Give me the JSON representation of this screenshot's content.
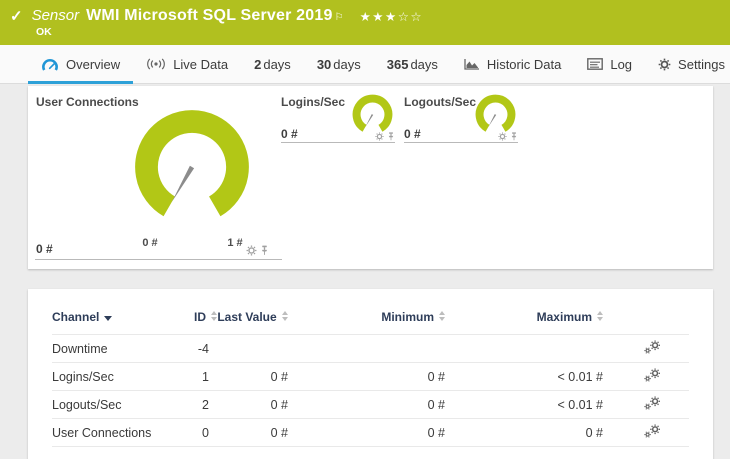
{
  "header": {
    "status_icon": "check",
    "kind_label": "Sensor",
    "title": "WMI Microsoft SQL Server 2019",
    "status": "OK",
    "rating": {
      "filled": 3,
      "total": 5,
      "filled_stars": "★★★",
      "empty_stars": "☆☆"
    }
  },
  "tabs": [
    {
      "label": "Overview",
      "icon": "gauge-icon",
      "active": true
    },
    {
      "label": "Live Data",
      "icon": "live-data-icon"
    },
    {
      "strong": "2",
      "label": "days"
    },
    {
      "strong": "30",
      "label": "days"
    },
    {
      "strong": "365",
      "label": "days"
    },
    {
      "label": "Historic Data",
      "icon": "historic-data-icon"
    },
    {
      "label": "Log",
      "icon": "log-icon"
    },
    {
      "label": "Settings",
      "icon": "settings-gear-icon"
    }
  ],
  "gauge_panel": {
    "primary": {
      "title": "User Connections",
      "current_value": "0 #",
      "scale_start": "0 #",
      "scale_end": "1 #",
      "needle_value": 0,
      "icons": [
        "gear-icon",
        "pin-icon"
      ]
    },
    "secondary": [
      {
        "title": "Logins/Sec",
        "current_value": "0 #",
        "needle_value": 0,
        "icons": [
          "gear-icon",
          "pin-icon"
        ]
      },
      {
        "title": "Logouts/Sec",
        "current_value": "0 #",
        "needle_value": 0,
        "icons": [
          "gear-icon",
          "pin-icon"
        ]
      }
    ]
  },
  "table": {
    "sorted_by": "Channel",
    "columns": {
      "channel": "Channel",
      "id": "ID",
      "last_value": "Last Value",
      "minimum": "Minimum",
      "maximum": "Maximum"
    },
    "rows": [
      {
        "channel": "Downtime",
        "id": "-4",
        "last_value": "",
        "minimum": "",
        "maximum": ""
      },
      {
        "channel": "Logins/Sec",
        "id": "1",
        "last_value": "0 #",
        "minimum": "0 #",
        "maximum": "< 0.01 #"
      },
      {
        "channel": "Logouts/Sec",
        "id": "2",
        "last_value": "0 #",
        "minimum": "0 #",
        "maximum": "< 0.01 #"
      },
      {
        "channel": "User Connections",
        "id": "0",
        "last_value": "0 #",
        "minimum": "0 #",
        "maximum": "0 #"
      }
    ],
    "row_action_icon": "edit-channel-gears-icon"
  },
  "colors": {
    "header_green": "#b1c01f",
    "gauge_green": "#b2c716",
    "active_tab_blue": "#2ea1d8",
    "tab_icon_blue": "#2196d6",
    "table_header_navy": "#2e3d59",
    "needle_gray": "#8c8c8c",
    "page_background": "#ececec"
  }
}
